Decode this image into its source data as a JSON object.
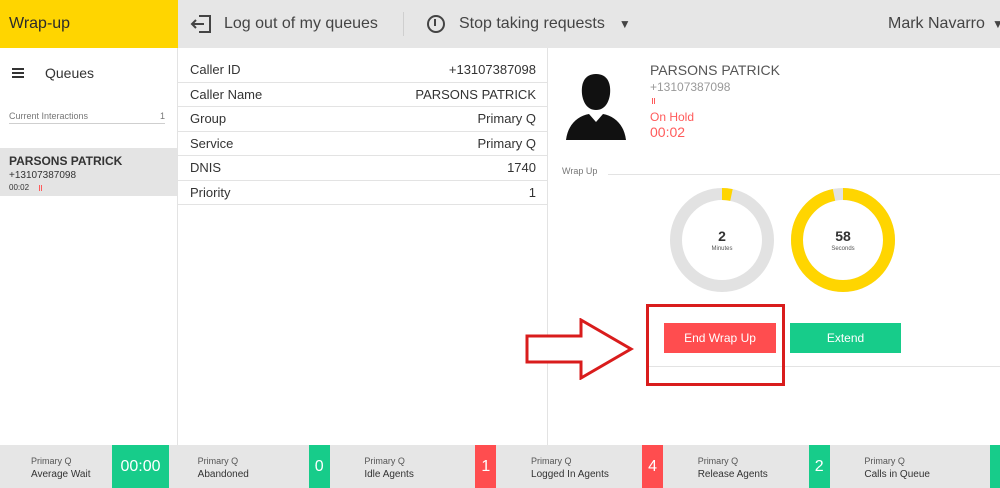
{
  "topbar": {
    "brand": "Wrap-up",
    "logout_label": "Log out of my queues",
    "stop_label": "Stop taking requests",
    "user_name": "Mark Navarro"
  },
  "sidebar": {
    "queues_label": "Queues",
    "current_interactions_label": "Current Interactions",
    "current_interactions_count": "1",
    "interaction": {
      "name": "PARSONS PATRICK",
      "phone": "+13107387098",
      "time": "00:02"
    }
  },
  "details": {
    "rows": [
      {
        "label": "Caller ID",
        "value": "+13107387098"
      },
      {
        "label": "Caller Name",
        "value": "PARSONS PATRICK"
      },
      {
        "label": "Group",
        "value": "Primary Q"
      },
      {
        "label": "Service",
        "value": "Primary Q"
      },
      {
        "label": "DNIS",
        "value": "1740"
      },
      {
        "label": "Priority",
        "value": "1"
      }
    ]
  },
  "caller": {
    "name": "PARSONS PATRICK",
    "phone": "+13107387098",
    "status": "On Hold",
    "timer": "00:02"
  },
  "wrapup": {
    "section_label": "Wrap Up",
    "minutes_value": "2",
    "minutes_label": "Minutes",
    "minutes_fraction": 0.033,
    "seconds_value": "58",
    "seconds_label": "Seconds",
    "seconds_fraction": 0.967,
    "end_label": "End Wrap Up",
    "extend_label": "Extend"
  },
  "stats": [
    {
      "queue": "Primary Q",
      "name": "Average Wait",
      "value": "00:00",
      "color": "#17cc8a"
    },
    {
      "queue": "Primary Q",
      "name": "Abandoned",
      "value": "0",
      "color": "#17cc8a"
    },
    {
      "queue": "Primary Q",
      "name": "Idle Agents",
      "value": "1",
      "color": "#ff4d4f"
    },
    {
      "queue": "Primary Q",
      "name": "Logged In Agents",
      "value": "4",
      "color": "#ff4d4f"
    },
    {
      "queue": "Primary Q",
      "name": "Release Agents",
      "value": "2",
      "color": "#17cc8a"
    },
    {
      "queue": "Primary Q",
      "name": "Calls in Queue",
      "value": "",
      "color": "#17cc8a"
    }
  ],
  "colors": {
    "brand_yellow": "#ffd500",
    "ring_gray": "#e2e2e2",
    "danger_red": "#ff4d4f",
    "success_green": "#17cc8a"
  }
}
